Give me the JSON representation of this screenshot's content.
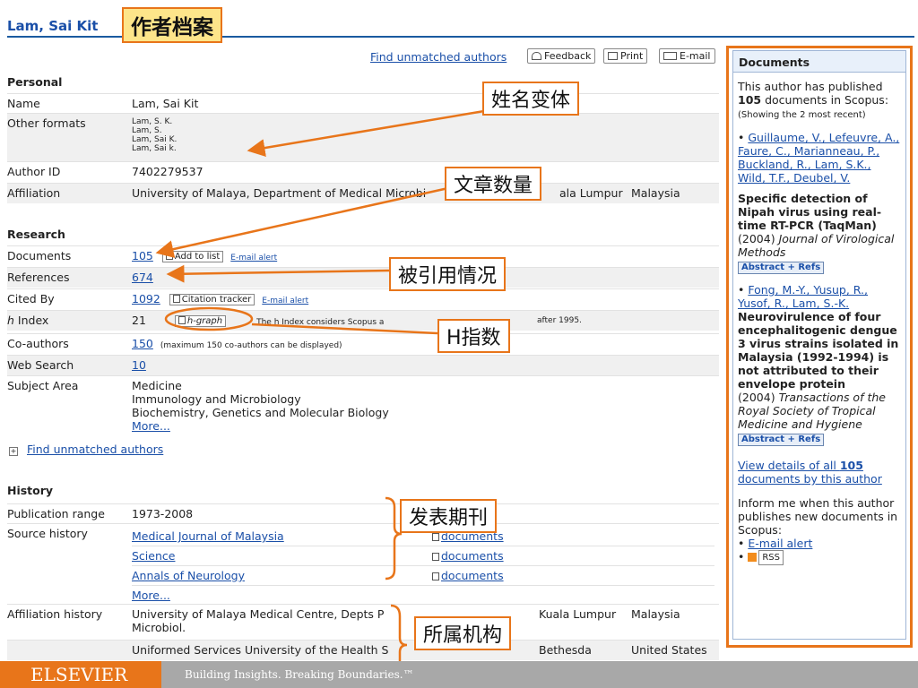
{
  "author_name": "Lam, Sai Kit",
  "annotations": {
    "header": "作者档案",
    "name_variants": "姓名变体",
    "doc_count": "文章数量",
    "citations": "被引用情况",
    "h_index": "H指数",
    "journals": "发表期刊",
    "affiliation": "所属机构"
  },
  "toolbar": {
    "find_unmatched": "Find unmatched authors",
    "feedback": "Feedback",
    "print": "Print",
    "email": "E-mail"
  },
  "personal": {
    "heading": "Personal",
    "name_label": "Name",
    "name_value": "Lam, Sai Kit",
    "other_formats_label": "Other formats",
    "other_formats": [
      "Lam, S. K.",
      "Lam, S.",
      "Lam, Sai K.",
      "Lam, Sai k."
    ],
    "author_id_label": "Author ID",
    "author_id": "7402279537",
    "affiliation_label": "Affiliation",
    "affiliation_value": "University of Malaya, Department of Medical Microbi",
    "affiliation_city": "ala Lumpur",
    "affiliation_country": "Malaysia"
  },
  "research": {
    "heading": "Research",
    "documents_label": "Documents",
    "documents": "105",
    "add_to_list": "Add to list",
    "email_alert": "E-mail alert",
    "references_label": "References",
    "references": "674",
    "cited_by_label": "Cited By",
    "cited_by": "1092",
    "citation_tracker": "Citation tracker",
    "h_index_label_i": "h",
    "h_index_label": " Index",
    "h_index": "21",
    "h_graph": "h-graph",
    "h_note": "The h Index considers Scopus a",
    "h_note_tail": "after 1995.",
    "coauthors_label": "Co-authors",
    "coauthors": "150",
    "coauthors_note": "(maximum 150 co-authors can be displayed)",
    "web_search_label": "Web Search",
    "web_search": "10",
    "subject_label": "Subject Area",
    "subjects": [
      "Medicine",
      "Immunology and Microbiology",
      "Biochemistry, Genetics and Molecular Biology"
    ],
    "more": "More..."
  },
  "find_unmatched_bottom": "Find unmatched authors",
  "history": {
    "heading": "History",
    "pub_range_label": "Publication range",
    "pub_range": "1973-2008",
    "source_label": "Source history",
    "sources": [
      "Medical Journal of Malaysia",
      "Science",
      "Annals of Neurology"
    ],
    "documents_link": "documents",
    "more": "More...",
    "aff_label": "Affiliation history",
    "aff1": "University of Malaya Medical Centre, Depts",
    "aff1_mid": "P",
    "aff1_line2": "Microbiol.",
    "aff1_city": "Kuala Lumpur",
    "aff1_country": "Malaysia",
    "aff2": "Uniformed Services University of the Health S",
    "aff2_city": "Bethesda",
    "aff2_country": "United States"
  },
  "sidebar": {
    "heading": "Documents",
    "intro_pre": "This author has published ",
    "intro_count": "105",
    "intro_post": " documents in Scopus:",
    "showing": "(Showing the 2 most recent)",
    "doc1_authors": "Guillaume, V., Lefeuvre, A., Faure, C., Marianneau, P., Buckland, R., Lam, S.K., Wild, T.F., Deubel, V.",
    "doc1_title": "Specific detection of Nipah virus using real-time RT-PCR (TaqMan)",
    "doc1_year": "(2004)",
    "doc1_journal": "Journal of Virological Methods",
    "doc2_authors": "Fong, M.-Y., Yusup, R., Yusof, R., Lam, S.-K.",
    "doc2_title": "Neurovirulence of four encephalitogenic dengue 3 virus strains isolated in Malaysia (1992-1994) is not attributed to their envelope protein",
    "doc2_year": "(2004)",
    "doc2_journal": "Transactions of the Royal Society of Tropical Medicine and Hygiene",
    "abstract_refs": "Abstract + Refs",
    "view_all_pre": "View details of all ",
    "view_all_count": "105",
    "view_all_post": " documents by this author",
    "inform": "Inform me when this author publishes new documents in Scopus:",
    "email_alert": "E-mail alert",
    "rss": "RSS"
  },
  "footer": {
    "logo": "ELSEVIER",
    "tagline": "Building Insights. Breaking Boundaries.™"
  },
  "colors": {
    "accent_orange": "#e8751a",
    "link_blue": "#1a4fa8",
    "header_yellow": "#fde58a"
  }
}
